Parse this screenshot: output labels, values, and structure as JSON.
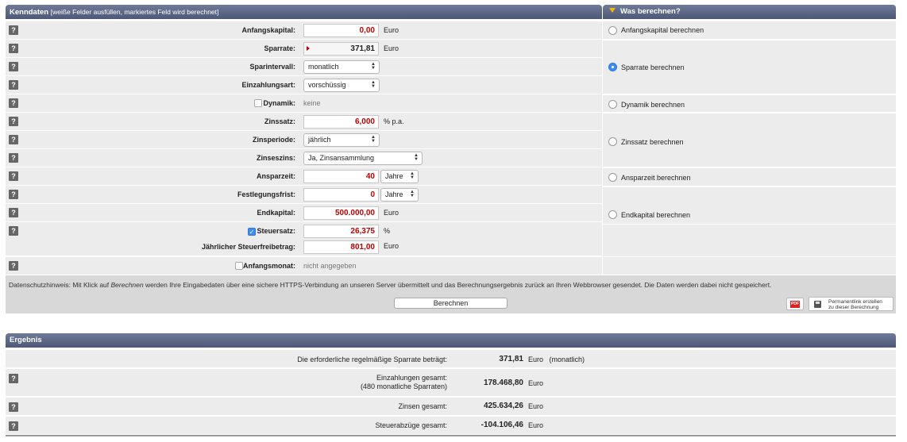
{
  "kenndaten": {
    "title": "Kenndaten",
    "subtitle": "[weiße Felder ausfüllen, markiertes Feld wird berechnet]",
    "help_glyph": "?",
    "rows": {
      "anfangskapital": {
        "label": "Anfangskapital:",
        "value": "0,00",
        "unit": "Euro"
      },
      "sparrate": {
        "label": "Sparrate:",
        "value": "371,81",
        "unit": "Euro"
      },
      "sparintervall": {
        "label": "Sparintervall:",
        "value": "monatlich"
      },
      "einzahlungsart": {
        "label": "Einzahlungsart:",
        "value": "vorschüssig"
      },
      "dynamik": {
        "label": "Dynamik:",
        "value": "keine",
        "checked": false
      },
      "zinssatz": {
        "label": "Zinssatz:",
        "value": "6,000",
        "unit": "% p.a."
      },
      "zinsperiode": {
        "label": "Zinsperiode:",
        "value": "jährlich"
      },
      "zinseszins": {
        "label": "Zinseszins:",
        "value": "Ja, Zinsansammlung"
      },
      "ansparzeit": {
        "label": "Ansparzeit:",
        "value": "40",
        "unit": "Jahre"
      },
      "festlegungsfrist": {
        "label": "Festlegungsfrist:",
        "value": "0",
        "unit": "Jahre"
      },
      "endkapital": {
        "label": "Endkapital:",
        "value": "500.000,00",
        "unit": "Euro"
      },
      "steuersatz": {
        "label": "Steuersatz:",
        "value": "26,375",
        "unit": "%",
        "checked": true
      },
      "steuerfreibetrag": {
        "label": "Jährlicher Steuerfreibetrag:",
        "value": "801,00",
        "unit": "Euro"
      },
      "anfangsmonat": {
        "label": "Anfangsmonat:",
        "value": "nicht angegeben",
        "checked": false
      }
    }
  },
  "was_berechnen": {
    "title": "Was berechnen?",
    "selected": "sparrate",
    "options": [
      {
        "id": "anfangskapital",
        "label": "Anfangskapital berechnen"
      },
      {
        "id": "sparrate",
        "label": "Sparrate berechnen"
      },
      {
        "id": "dynamik",
        "label": "Dynamik berechnen"
      },
      {
        "id": "zinssatz",
        "label": "Zinssatz berechnen"
      },
      {
        "id": "ansparzeit",
        "label": "Ansparzeit berechnen"
      },
      {
        "id": "endkapital",
        "label": "Endkapital berechnen"
      }
    ]
  },
  "privacy": {
    "text_before": "Datenschutzhinweis: Mit Klick auf ",
    "text_em": "Berechnen",
    "text_after": " werden Ihre Eingabedaten über eine sichere HTTPS-Verbindung an unseren Server übermittelt und das Berechnungsergebnis zurück an Ihren Webbrowser gesendet. Die Daten werden dabei nicht gespeichert.",
    "calc_button": "Berechnen",
    "pdf_label": "PDF",
    "permalink_line1": "Permanentlink erstellen",
    "permalink_line2": "zu dieser Berechnung"
  },
  "ergebnis": {
    "title": "Ergebnis",
    "rows": {
      "sparrate": {
        "label": "Die erforderliche regelmäßige Sparrate beträgt:",
        "value": "371,81",
        "unit": "Euro",
        "extra": "(monatlich)"
      },
      "einzahlungen": {
        "label": "Einzahlungen gesamt:",
        "label2": "(480 monatliche Sparraten)",
        "value": "178.468,80",
        "unit": "Euro"
      },
      "zinsen": {
        "label": "Zinsen gesamt:",
        "value": "425.634,26",
        "unit": "Euro"
      },
      "steuer": {
        "label": "Steuerabzüge gesamt:",
        "value": "-104.106,46",
        "unit": "Euro"
      }
    }
  },
  "colors": {
    "header": "#56617f",
    "accent_input": "#c00000",
    "radio_selected": "#3d8ef0"
  }
}
